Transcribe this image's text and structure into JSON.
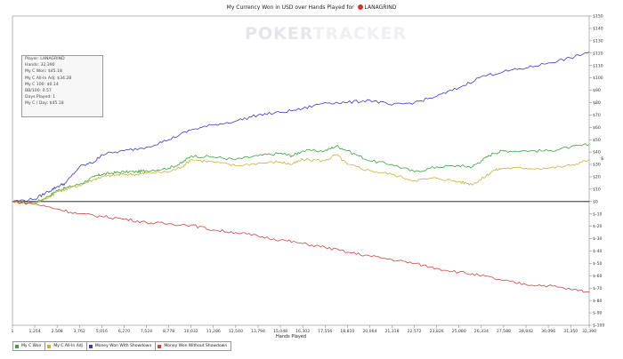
{
  "window": {
    "title_prefix": "My Currency Won in USD over Hands Played for",
    "player_name": "LANAGRIND",
    "watermark_a": "POKER",
    "watermark_b": "TRACKER",
    "y_side_marker": "$"
  },
  "stats_box": {
    "lines": [
      "Player: LANAGRIND",
      "Hands: 32,390",
      "My C Won: $45.18",
      "My C All-In Adj: $34.28",
      "My C 100: $0.14",
      "BB/100: 0.57",
      "Days Played: 1",
      "My C / Day: $45.18"
    ]
  },
  "chart_data": {
    "type": "line",
    "title": "My Currency Won in USD over Hands Played for LANAGRIND",
    "xlabel": "Hands Played",
    "ylabel": "",
    "xlim": [
      1,
      32390
    ],
    "ylim": [
      -100,
      150
    ],
    "x_ticks": [
      "1",
      "1,254",
      "2,508",
      "3,762",
      "5,016",
      "6,270",
      "7,524",
      "8,778",
      "10,032",
      "11,286",
      "12,540",
      "13,794",
      "15,048",
      "16,302",
      "17,556",
      "18,810",
      "20,064",
      "21,318",
      "22,572",
      "23,826",
      "25,080",
      "26,334",
      "27,588",
      "28,842",
      "30,096",
      "31,350",
      "32,390"
    ],
    "y_ticks": [
      "$150",
      "$140",
      "$130",
      "$120",
      "$110",
      "$100",
      "$90",
      "$80",
      "$70",
      "$60",
      "$50",
      "$40",
      "$30",
      "$20",
      "$10",
      "$0",
      "$-10",
      "$-20",
      "$-30",
      "$-40",
      "$-50",
      "$-60",
      "$-70",
      "$-80",
      "$-90",
      "$-100"
    ],
    "grid": "none",
    "legend": "bottom-left",
    "series": [
      {
        "name": "My C Won",
        "color": "#3aa33a",
        "points": [
          [
            1,
            0
          ],
          [
            1254,
            -1
          ],
          [
            2000,
            4
          ],
          [
            2508,
            9
          ],
          [
            3000,
            11
          ],
          [
            3762,
            14
          ],
          [
            4600,
            20
          ],
          [
            5016,
            22
          ],
          [
            5600,
            23
          ],
          [
            6270,
            24
          ],
          [
            7000,
            24
          ],
          [
            7524,
            25
          ],
          [
            8778,
            27
          ],
          [
            9500,
            31
          ],
          [
            10032,
            37
          ],
          [
            11286,
            36
          ],
          [
            12540,
            34
          ],
          [
            13794,
            37
          ],
          [
            15048,
            39
          ],
          [
            15700,
            37
          ],
          [
            16302,
            41
          ],
          [
            17556,
            41
          ],
          [
            18200,
            45
          ],
          [
            18810,
            41
          ],
          [
            20064,
            33
          ],
          [
            21318,
            30
          ],
          [
            22572,
            24
          ],
          [
            23826,
            28
          ],
          [
            25080,
            29
          ],
          [
            25800,
            28
          ],
          [
            26334,
            33
          ],
          [
            27000,
            39
          ],
          [
            27588,
            41
          ],
          [
            28842,
            41
          ],
          [
            30096,
            41
          ],
          [
            31350,
            44
          ],
          [
            32390,
            46
          ]
        ]
      },
      {
        "name": "My C All-In Adj",
        "color": "#c8b23c",
        "points": [
          [
            1,
            0
          ],
          [
            1254,
            -1
          ],
          [
            2000,
            3
          ],
          [
            2508,
            8
          ],
          [
            3000,
            10
          ],
          [
            3762,
            13
          ],
          [
            4600,
            18
          ],
          [
            5016,
            20
          ],
          [
            5600,
            21
          ],
          [
            6270,
            22
          ],
          [
            7000,
            22
          ],
          [
            7524,
            23
          ],
          [
            8778,
            24
          ],
          [
            9500,
            28
          ],
          [
            10032,
            34
          ],
          [
            11286,
            32
          ],
          [
            12540,
            29
          ],
          [
            13794,
            31
          ],
          [
            15048,
            32
          ],
          [
            15700,
            30
          ],
          [
            16302,
            34
          ],
          [
            17556,
            33
          ],
          [
            18200,
            38
          ],
          [
            18810,
            30
          ],
          [
            20064,
            25
          ],
          [
            21318,
            22
          ],
          [
            22572,
            17
          ],
          [
            23826,
            19
          ],
          [
            25080,
            16
          ],
          [
            25800,
            14
          ],
          [
            26334,
            18
          ],
          [
            27000,
            25
          ],
          [
            27588,
            27
          ],
          [
            28842,
            27
          ],
          [
            30096,
            27
          ],
          [
            31350,
            29
          ],
          [
            32390,
            34
          ]
        ]
      },
      {
        "name": "Money Won With Showdown",
        "color": "#3a3acb",
        "points": [
          [
            1,
            0
          ],
          [
            1254,
            2
          ],
          [
            2000,
            8
          ],
          [
            2508,
            12
          ],
          [
            3000,
            15
          ],
          [
            3762,
            28
          ],
          [
            4600,
            32
          ],
          [
            5016,
            38
          ],
          [
            6270,
            41
          ],
          [
            7524,
            44
          ],
          [
            8778,
            50
          ],
          [
            10032,
            58
          ],
          [
            11286,
            62
          ],
          [
            12540,
            65
          ],
          [
            13794,
            70
          ],
          [
            15048,
            72
          ],
          [
            16302,
            75
          ],
          [
            17556,
            80
          ],
          [
            18810,
            80
          ],
          [
            20064,
            82
          ],
          [
            21318,
            78
          ],
          [
            22572,
            80
          ],
          [
            23826,
            85
          ],
          [
            25080,
            92
          ],
          [
            26334,
            101
          ],
          [
            27588,
            105
          ],
          [
            28842,
            108
          ],
          [
            30096,
            112
          ],
          [
            31350,
            116
          ],
          [
            32390,
            121
          ]
        ]
      },
      {
        "name": "Money Won Without Showdown",
        "color": "#cc4444",
        "points": [
          [
            1,
            0
          ],
          [
            1254,
            -2
          ],
          [
            2508,
            -6
          ],
          [
            3762,
            -10
          ],
          [
            5016,
            -12
          ],
          [
            6270,
            -14
          ],
          [
            7524,
            -17
          ],
          [
            8778,
            -18
          ],
          [
            10032,
            -19
          ],
          [
            11286,
            -23
          ],
          [
            12540,
            -25
          ],
          [
            13794,
            -28
          ],
          [
            15048,
            -31
          ],
          [
            16302,
            -34
          ],
          [
            17556,
            -37
          ],
          [
            18810,
            -41
          ],
          [
            20064,
            -44
          ],
          [
            21318,
            -47
          ],
          [
            22572,
            -50
          ],
          [
            23826,
            -54
          ],
          [
            25080,
            -57
          ],
          [
            26334,
            -60
          ],
          [
            27588,
            -64
          ],
          [
            28842,
            -67
          ],
          [
            30096,
            -68
          ],
          [
            31350,
            -71
          ],
          [
            32390,
            -73
          ]
        ]
      }
    ]
  }
}
